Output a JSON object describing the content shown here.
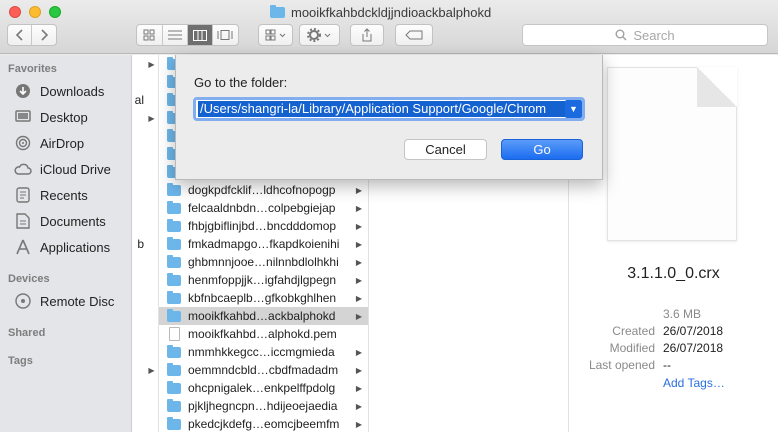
{
  "window": {
    "title": "mooikfkahbdckldjjndioackbalphokd",
    "traffic_lights": [
      "close",
      "minimize",
      "zoom"
    ]
  },
  "toolbar": {
    "back_icon": "chevron-left-icon",
    "forward_icon": "chevron-right-icon",
    "view_modes": [
      "icon-view",
      "list-view",
      "column-view",
      "gallery-view"
    ],
    "active_view": "column-view",
    "search_placeholder": "Search"
  },
  "sidebar": {
    "favorites_label": "Favorites",
    "favorites": [
      {
        "label": "Downloads",
        "icon": "downloads-icon"
      },
      {
        "label": "Desktop",
        "icon": "desktop-icon"
      },
      {
        "label": "AirDrop",
        "icon": "airdrop-icon"
      },
      {
        "label": "iCloud Drive",
        "icon": "cloud-icon"
      },
      {
        "label": "Recents",
        "icon": "clock-icon"
      },
      {
        "label": "Documents",
        "icon": "documents-icon"
      },
      {
        "label": "Applications",
        "icon": "applications-icon"
      }
    ],
    "devices_label": "Devices",
    "devices": [
      {
        "label": "Remote Disc",
        "icon": "disc-icon"
      }
    ],
    "shared_label": "Shared",
    "tags_label": "Tags"
  },
  "column1": {
    "fragments": [
      "al",
      "b"
    ]
  },
  "column2": {
    "items": [
      {
        "name": "dogkpdfcklif…ldhcofnopogp",
        "type": "folder"
      },
      {
        "name": "felcaaldnbdn…colpebgiejap",
        "type": "folder"
      },
      {
        "name": "fhbjgbiflinjbd…bncdddomop",
        "type": "folder"
      },
      {
        "name": "fmkadmapgo…fkapdkoienihi",
        "type": "folder"
      },
      {
        "name": "ghbmnnjooe…nilnnbdlolhkhi",
        "type": "folder"
      },
      {
        "name": "henmfoppjjk…igfahdjlgpegn",
        "type": "folder"
      },
      {
        "name": "kbfnbcaeplb…gfkobkghlhen",
        "type": "folder"
      },
      {
        "name": "mooikfkahbd…ackbalphokd",
        "type": "folder",
        "selected": true
      },
      {
        "name": "mooikfkahbd…alphokd.pem",
        "type": "file"
      },
      {
        "name": "nmmhkkegcc…iccmgmieda",
        "type": "folder"
      },
      {
        "name": "oemmndcbld…cbdfmadadm",
        "type": "folder"
      },
      {
        "name": "ohcpnigalek…enkpelffpdolg",
        "type": "folder"
      },
      {
        "name": "pjkljhegncpn…hdijeoejaedia",
        "type": "folder"
      },
      {
        "name": "pkedcjkdefg…eomcjbeemfm",
        "type": "folder"
      }
    ]
  },
  "preview": {
    "filename": "3.1.1.0_0.crx",
    "size": "3.6 MB",
    "created_label": "Created",
    "created": "26/07/2018",
    "modified_label": "Modified",
    "modified": "26/07/2018",
    "last_opened_label": "Last opened",
    "last_opened": "--",
    "add_tags": "Add Tags…"
  },
  "dialog": {
    "label": "Go to the folder:",
    "path": "/Users/shangri-la/Library/Application Support/Google/Chrome/Default/Extensions/mooikfkahbdckldjjndioackbalphokd",
    "path_display": "/Users/shangri-la/Library/Application Support/Google/Chrom",
    "cancel_label": "Cancel",
    "go_label": "Go",
    "accent": "#1b6cf0"
  }
}
